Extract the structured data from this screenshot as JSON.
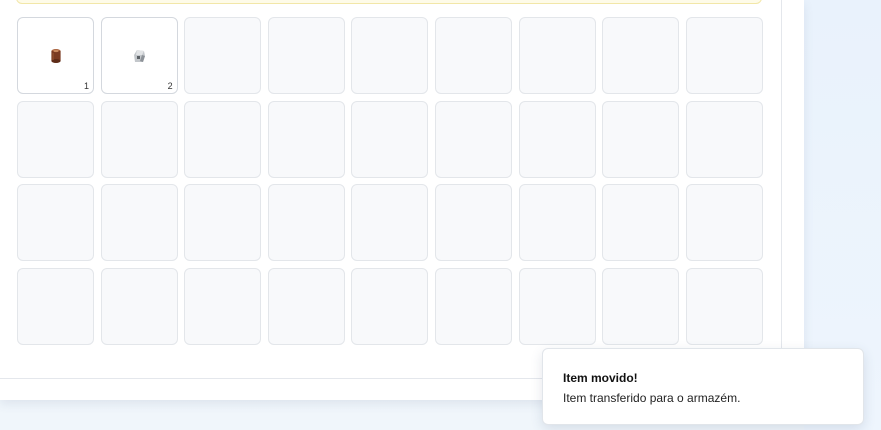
{
  "inventory": {
    "slots": [
      {
        "icon": "log-icon",
        "quantity": "1"
      },
      {
        "icon": "stone-icon",
        "quantity": "2"
      },
      {},
      {},
      {},
      {},
      {},
      {},
      {},
      {},
      {},
      {},
      {},
      {},
      {},
      {},
      {},
      {},
      {},
      {},
      {},
      {},
      {},
      {},
      {},
      {},
      {},
      {},
      {},
      {},
      {},
      {},
      {},
      {},
      {},
      {}
    ]
  },
  "toast": {
    "title": "Item movido!",
    "message": "Item transferido para o armazém."
  },
  "colors": {
    "banner_bg": "#fefbe8",
    "slot_bg": "#f8f9fb",
    "log": "#7a3b22",
    "stone": "#9ea3a8"
  }
}
